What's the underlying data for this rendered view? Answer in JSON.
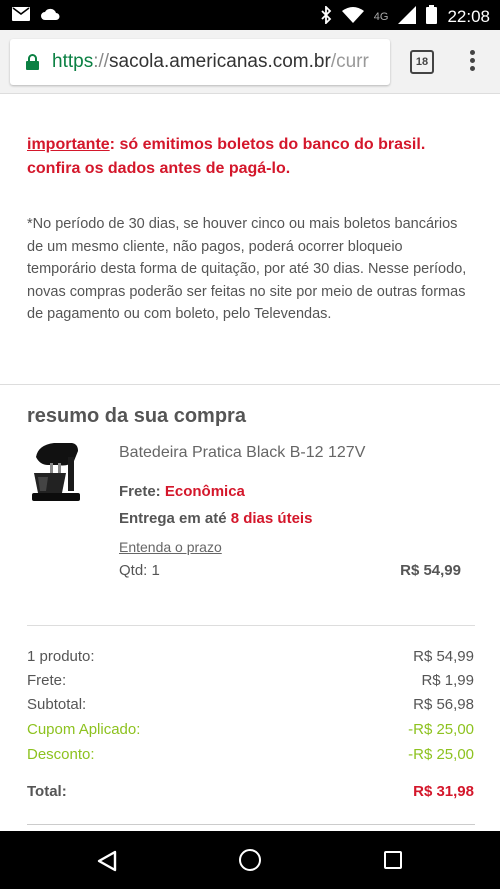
{
  "status_bar": {
    "time": "22:08",
    "network": "4G",
    "icons": [
      "mail-icon",
      "cloud-icon",
      "bluetooth-icon",
      "wifi-icon",
      "signal-icon",
      "battery-icon"
    ]
  },
  "browser": {
    "url_scheme": "https",
    "url_sep": "://",
    "url_host": "sacola.americanas.com.br",
    "url_path": "/curr",
    "tab_count": "18",
    "secure_color": "#0b8043"
  },
  "notice": {
    "important_label": "importante",
    "important_text": ": só emitimos boletos do banco do brasil. confira os dados antes de pagá-lo.",
    "body": "*No período de 30 dias, se houver cinco ou mais boletos bancários de um mesmo cliente, não pagos, poderá ocorrer bloqueio temporário desta forma de quitação, por até 30 dias. Nesse período, novas compras poderão ser feitas no site por meio de outras formas de pagamento ou com boleto, pelo Televendas."
  },
  "summary": {
    "title": "resumo da sua compra",
    "product": {
      "name": "Batedeira Pratica Black B-12 127V",
      "frete_label": "Frete:",
      "frete_value": "Econômica",
      "entrega_label": "Entrega em até",
      "entrega_value": "8 dias úteis",
      "prazo_link": "Entenda o prazo",
      "qtd": "Qtd: 1",
      "price": "R$ 54,99"
    },
    "rows": {
      "produtos": {
        "label": "1 produto:",
        "value": "R$ 54,99"
      },
      "frete": {
        "label": "Frete:",
        "value": "R$ 1,99"
      },
      "subtotal": {
        "label": "Subtotal:",
        "value": "R$ 56,98"
      },
      "cupom": {
        "label": "Cupom Aplicado:",
        "value": "-R$ 25,00"
      },
      "desconto": {
        "label": "Desconto:",
        "value": "-R$ 25,00"
      },
      "total": {
        "label": "Total:",
        "value": "R$ 31,98"
      }
    }
  },
  "colors": {
    "accent_red": "#d4172b",
    "discount_green": "#8dc21f"
  }
}
